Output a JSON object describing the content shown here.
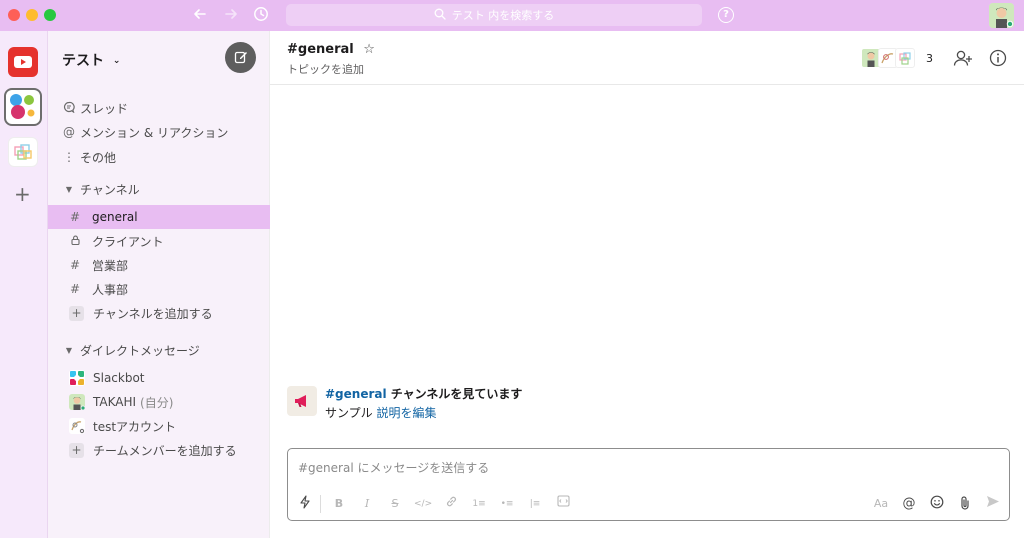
{
  "titlebar": {
    "search_placeholder": "テスト 内を検索する",
    "help_label": "?"
  },
  "workspaces": [
    {
      "name": "youtube"
    },
    {
      "name": "current"
    },
    {
      "name": "other"
    }
  ],
  "sidebar": {
    "team_name": "テスト",
    "nav": [
      {
        "icon": "thread-icon",
        "label": "スレッド"
      },
      {
        "icon": "at-icon",
        "label": "メンション & リアクション"
      },
      {
        "icon": "more-vertical-icon",
        "label": "その他"
      }
    ],
    "channels_header": "チャンネル",
    "channels": [
      {
        "prefix": "#",
        "name": "general",
        "active": true
      },
      {
        "prefix": "lock",
        "name": "クライアント",
        "active": false
      },
      {
        "prefix": "#",
        "name": "営業部",
        "active": false
      },
      {
        "prefix": "#",
        "name": "人事部",
        "active": false
      }
    ],
    "add_channel_label": "チャンネルを追加する",
    "dm_header": "ダイレクトメッセージ",
    "dms": [
      {
        "name": "Slackbot"
      },
      {
        "name": "TAKAHI",
        "suffix": "(自分)"
      },
      {
        "name": "testアカウント"
      }
    ],
    "add_member_label": "チームメンバーを追加する"
  },
  "channel": {
    "name": "#general",
    "topic": "トピックを追加",
    "member_count": "3"
  },
  "intro": {
    "channel_link": "#general",
    "title_rest": " チャンネルを見ています",
    "desc": "サンプル",
    "edit_link": "説明を編集"
  },
  "composer": {
    "placeholder": "#general にメッセージを送信する",
    "format_aa": "Aa"
  }
}
